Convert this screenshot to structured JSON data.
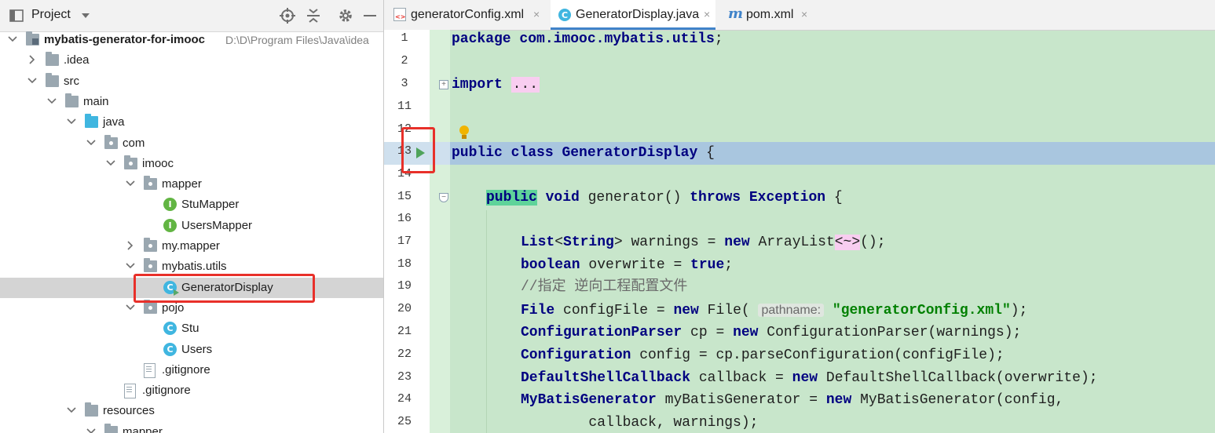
{
  "project_panel": {
    "title": "Project",
    "icons": [
      "project-icon",
      "dropdown-icon",
      "locate-icon",
      "collapse-all-icon",
      "settings-icon",
      "minimize-icon"
    ]
  },
  "tree": [
    {
      "label": "mybatis-generator-for-imooc",
      "path": "D:\\D\\Program Files\\Java\\idea",
      "icon": "module-folder",
      "arrow": "down",
      "depth": 0,
      "bold": true
    },
    {
      "label": ".idea",
      "icon": "folder",
      "arrow": "right",
      "depth": 1
    },
    {
      "label": "src",
      "icon": "folder",
      "arrow": "down",
      "depth": 1
    },
    {
      "label": "main",
      "icon": "folder",
      "arrow": "down",
      "depth": 2
    },
    {
      "label": "java",
      "icon": "source-folder",
      "arrow": "down",
      "depth": 3
    },
    {
      "label": "com",
      "icon": "package",
      "arrow": "down",
      "depth": 4
    },
    {
      "label": "imooc",
      "icon": "package",
      "arrow": "down",
      "depth": 5
    },
    {
      "label": "mapper",
      "icon": "package",
      "arrow": "down",
      "depth": 6
    },
    {
      "label": "StuMapper",
      "icon": "interface",
      "arrow": "",
      "depth": 7
    },
    {
      "label": "UsersMapper",
      "icon": "interface",
      "arrow": "",
      "depth": 7
    },
    {
      "label": "my.mapper",
      "icon": "package",
      "arrow": "right",
      "depth": 6
    },
    {
      "label": "mybatis.utils",
      "icon": "package",
      "arrow": "down",
      "depth": 6
    },
    {
      "label": "GeneratorDisplay",
      "icon": "runnable-class",
      "arrow": "",
      "depth": 7,
      "selected": true
    },
    {
      "label": "pojo",
      "icon": "package",
      "arrow": "down",
      "depth": 6
    },
    {
      "label": "Stu",
      "icon": "class",
      "arrow": "",
      "depth": 7
    },
    {
      "label": "Users",
      "icon": "class",
      "arrow": "",
      "depth": 7
    },
    {
      "label": ".gitignore",
      "icon": "file",
      "arrow": "",
      "depth": 6
    },
    {
      "label": ".gitignore",
      "icon": "file",
      "arrow": "",
      "depth": 5
    },
    {
      "label": "resources",
      "icon": "resources-folder",
      "arrow": "down",
      "depth": 3
    },
    {
      "label": "mapper",
      "icon": "folder",
      "arrow": "down",
      "depth": 4
    }
  ],
  "tabs": [
    {
      "label": "generatorConfig.xml",
      "icon": "xml-file-icon",
      "close": "×"
    },
    {
      "label": "GeneratorDisplay.java",
      "icon": "java-class-icon",
      "close": "×",
      "active": true
    },
    {
      "label": "pom.xml",
      "icon": "maven-icon",
      "close": "×"
    }
  ],
  "line_numbers": [
    "1",
    "2",
    "3",
    "11",
    "12",
    "13",
    "14",
    "15",
    "16",
    "17",
    "18",
    "19",
    "20",
    "21",
    "22",
    "23",
    "24",
    "25"
  ],
  "code": {
    "l1": [
      "package ",
      "com.imooc.mybatis.utils",
      ";"
    ],
    "l3": [
      "import ",
      "..."
    ],
    "l13": [
      "public class ",
      "GeneratorDisplay",
      " {"
    ],
    "l15": [
      "public",
      " void ",
      "generator",
      "() ",
      "throws ",
      "Exception",
      " {"
    ],
    "l17": [
      "List",
      "<",
      "String",
      "> warnings = ",
      "new ",
      "ArrayList",
      "<~>",
      "();"
    ],
    "l18": [
      "boolean ",
      "overwrite = ",
      "true",
      ";"
    ],
    "l19": [
      "//指定 逆向工程配置文件"
    ],
    "l20": [
      "File ",
      "configFile = ",
      "new ",
      "File( ",
      "pathname:",
      " ",
      "\"generatorConfig.xml\"",
      ");"
    ],
    "l21": [
      "ConfigurationParser ",
      "cp = ",
      "new ",
      "ConfigurationParser(warnings);"
    ],
    "l22": [
      "Configuration ",
      "config = cp.parseConfiguration(configFile);"
    ],
    "l23": [
      "DefaultShellCallback ",
      "callback = ",
      "new ",
      "DefaultShellCallback(overwrite);"
    ],
    "l24": [
      "MyBatisGenerator ",
      "myBatisGenerator = ",
      "new ",
      "MyBatisGenerator(config,"
    ],
    "l25": [
      "        callback, warnings);"
    ]
  },
  "colors": {
    "editor_bg": "#c8e6cb",
    "caret_line": "#a9c6df",
    "keyword": "#000080",
    "string": "#008000",
    "highlight_box": "#e8302a",
    "selection": "#d4d4d4"
  }
}
